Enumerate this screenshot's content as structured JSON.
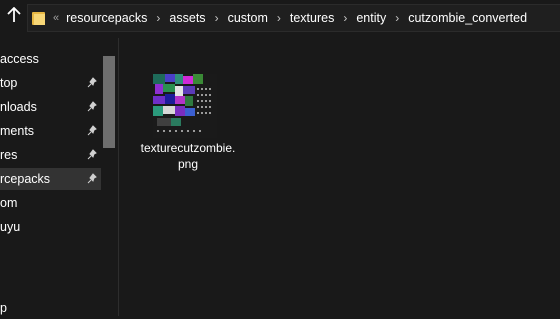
{
  "address_bar": {
    "overflow_chevron": "«",
    "path": [
      "resourcepacks",
      "assets",
      "custom",
      "textures",
      "entity",
      "cutzombie_converted"
    ],
    "separator": "›"
  },
  "nav_pane": {
    "items": [
      {
        "label": "access",
        "pinned": false,
        "selected": false
      },
      {
        "label": "top",
        "pinned": true,
        "selected": false
      },
      {
        "label": "nloads",
        "pinned": true,
        "selected": false
      },
      {
        "label": "ments",
        "pinned": true,
        "selected": false
      },
      {
        "label": "res",
        "pinned": true,
        "selected": false
      },
      {
        "label": "rcepacks",
        "pinned": true,
        "selected": true
      },
      {
        "label": "om",
        "pinned": false,
        "selected": false
      },
      {
        "label": "uyu",
        "pinned": false,
        "selected": false
      },
      {
        "label": "p",
        "pinned": false,
        "selected": false
      }
    ]
  },
  "files": [
    {
      "name": "texturecutzombie.png",
      "icon": "png-thumbnail"
    }
  ],
  "colors": {
    "background": "#191919",
    "selected": "#333333",
    "folder": "#f8d777",
    "scrollbar_thumb": "#6e6e6e"
  }
}
